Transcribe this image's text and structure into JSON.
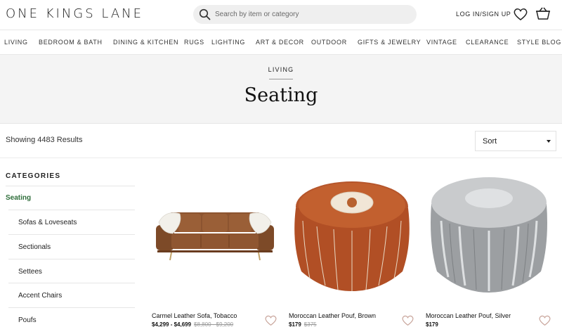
{
  "header": {
    "logo": "ONE KINGS LANE",
    "search_placeholder": "Search by item or category",
    "login": "LOG IN/SIGN UP",
    "icons": [
      "search-icon",
      "heart-icon",
      "cart-icon"
    ]
  },
  "nav": [
    "LIVING",
    "BEDROOM & BATH",
    "DINING & KITCHEN",
    "RUGS",
    "LIGHTING",
    "ART & DECOR",
    "OUTDOOR",
    "GIFTS & JEWELRY",
    "VINTAGE",
    "CLEARANCE",
    "STYLE BLOG"
  ],
  "hero": {
    "kicker": "LIVING",
    "title": "Seating"
  },
  "results": {
    "text": "Showing 4483 Results",
    "sort_label": "Sort"
  },
  "sidebar": {
    "title": "CATEGORIES",
    "active": "Seating",
    "items": [
      "Sofas & Loveseats",
      "Sectionals",
      "Settees",
      "Accent Chairs",
      "Poufs"
    ]
  },
  "products": [
    {
      "name": "Carmel Leather Sofa, Tobacco",
      "price": "$4,299 - $4,699",
      "orig": "$8,800 - $9,200"
    },
    {
      "name": "Moroccan Leather Pouf, Brown",
      "price": "$179",
      "orig": "$375"
    },
    {
      "name": "Moroccan Leather Pouf, Silver",
      "price": "$179",
      "orig": ""
    }
  ],
  "colors": {
    "accent_green": "#2f6e3b",
    "hero_bg": "#f4f4f4",
    "search_bg": "#efefef"
  }
}
